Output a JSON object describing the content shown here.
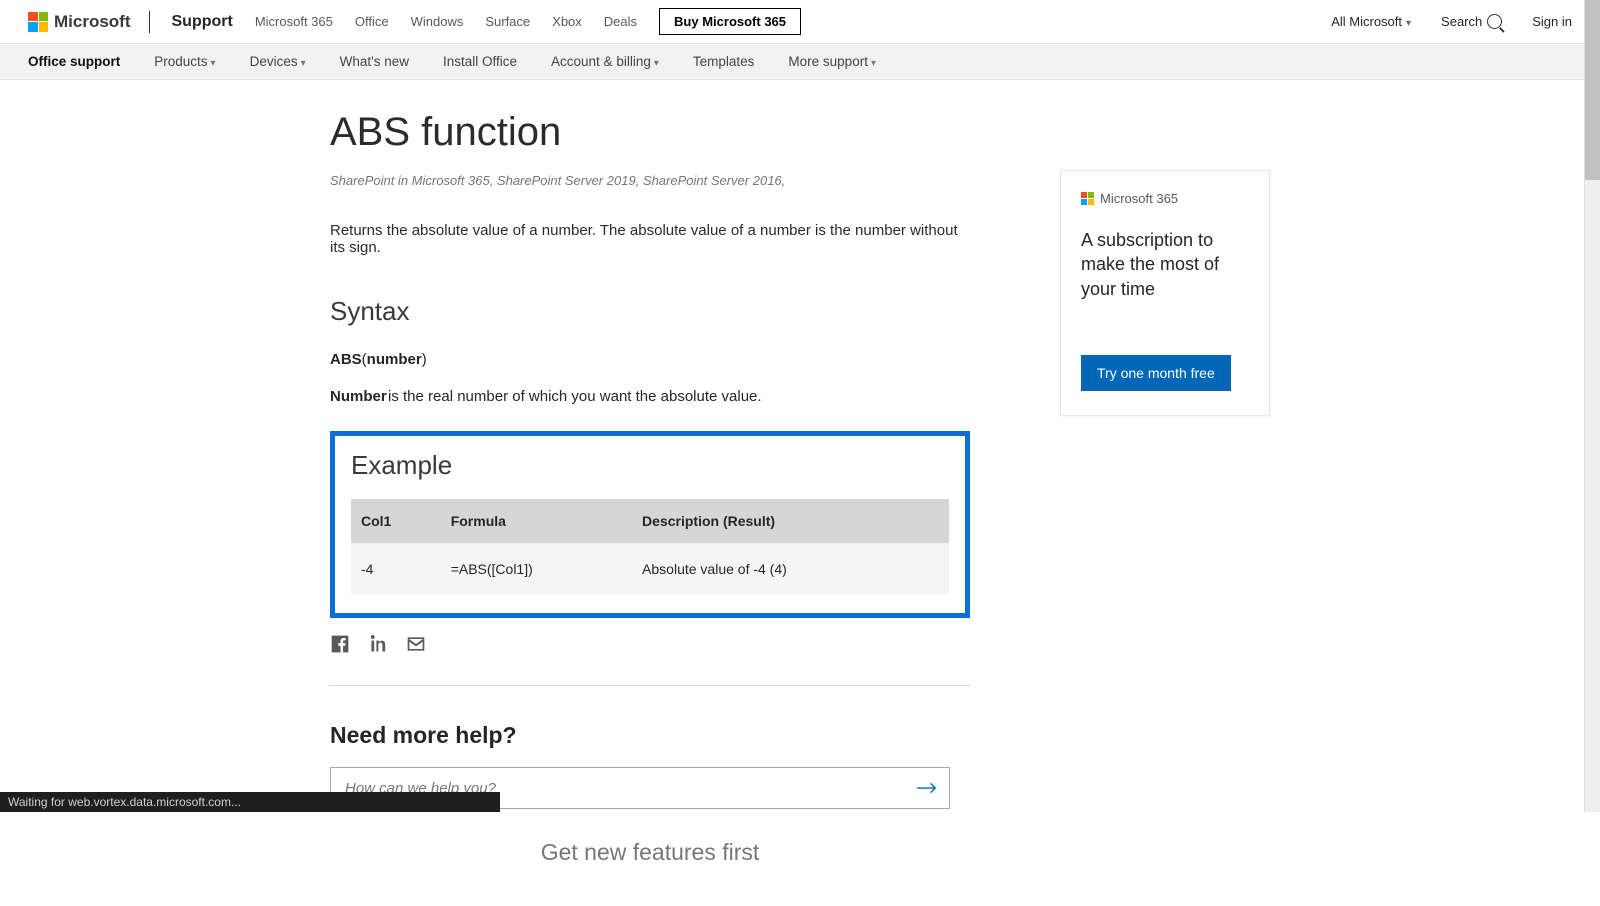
{
  "topnav": {
    "brand": "Microsoft",
    "support": "Support",
    "products": [
      "Microsoft 365",
      "Office",
      "Windows",
      "Surface",
      "Xbox",
      "Deals"
    ],
    "buy": "Buy Microsoft 365",
    "all": "All Microsoft",
    "search": "Search",
    "signin": "Sign in"
  },
  "subnav": {
    "items": [
      "Office support",
      "Products",
      "Devices",
      "What's new",
      "Install Office",
      "Account & billing",
      "Templates",
      "More support"
    ]
  },
  "article": {
    "title": "ABS function",
    "applies": "SharePoint in Microsoft 365, SharePoint Server 2019, SharePoint Server 2016,",
    "intro": "Returns the absolute value of a number. The absolute value of a number is the number without its sign.",
    "syntax_heading": "Syntax",
    "syntax_fn": "ABS",
    "syntax_arg": "number",
    "param_name": "Number",
    "param_desc": "is the real number of which you want the absolute value.",
    "example_heading": "Example",
    "table": {
      "headers": [
        "Col1",
        "Formula",
        "Description (Result)"
      ],
      "rows": [
        {
          "col1": "-4",
          "formula": "=ABS([Col1])",
          "desc": "Absolute value of -4 (4)"
        }
      ]
    },
    "need_more": "Need more help?",
    "help_placeholder": "How can we help you?",
    "getnew": "Get new features first"
  },
  "sidecard": {
    "brand": "Microsoft 365",
    "headline": "A subscription to make the most of your time",
    "cta": "Try one month free"
  },
  "status": "Waiting for web.vortex.data.microsoft.com..."
}
